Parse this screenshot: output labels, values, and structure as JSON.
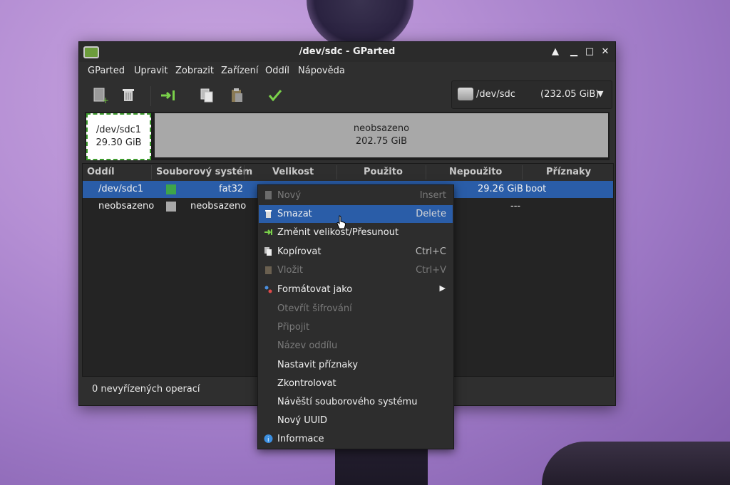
{
  "window": {
    "title": "/dev/sdc - GParted",
    "controls": [
      "▲",
      "▁",
      "□",
      "✕"
    ]
  },
  "menubar": [
    "GParted",
    "Upravit",
    "Zobrazit",
    "Zařízení",
    "Oddíl",
    "Nápověda"
  ],
  "device": {
    "name": "/dev/sdc",
    "size": "(232.05 GiB)"
  },
  "partition_map": [
    {
      "name": "/dev/sdc1",
      "size": "29.30 GiB"
    },
    {
      "name": "neobsazeno",
      "size": "202.75 GiB"
    }
  ],
  "table": {
    "headers": [
      "Oddíl",
      "Souborový systém",
      "Velikost",
      "Použito",
      "Nepoužito",
      "Příznaky"
    ],
    "rows": [
      {
        "partition": "/dev/sdc1",
        "fs": "fat32",
        "fs_color": "#3ea54a",
        "unused": "29.26 GiB",
        "flags": "boot"
      },
      {
        "partition": "neobsazeno",
        "fs": "neobsazeno",
        "fs_color": "#a8a8a8",
        "unused": "---",
        "flags": ""
      }
    ]
  },
  "statusbar": {
    "text": "0 nevyřízených operací"
  },
  "context_menu": {
    "items": [
      {
        "label": "Nový",
        "accel": "Insert",
        "icon": "new-icon",
        "disabled": true
      },
      {
        "label": "Smazat",
        "accel": "Delete",
        "icon": "delete-icon",
        "highlighted": true
      },
      {
        "label": "Změnit velikost/Přesunout",
        "accel": "",
        "icon": "resize-icon"
      },
      {
        "label": "Kopírovat",
        "accel": "Ctrl+C",
        "icon": "copy-icon"
      },
      {
        "label": "Vložit",
        "accel": "Ctrl+V",
        "icon": "paste-icon",
        "disabled": true
      },
      {
        "label": "Formátovat jako",
        "accel": "",
        "icon": "format-icon",
        "submenu": true
      },
      {
        "label": "Otevřít šifrování",
        "accel": "",
        "disabled": true
      },
      {
        "label": "Připojit",
        "accel": "",
        "disabled": true
      },
      {
        "label": "Název oddílu",
        "accel": "",
        "disabled": true
      },
      {
        "label": "Nastavit příznaky",
        "accel": ""
      },
      {
        "label": "Zkontrolovat",
        "accel": ""
      },
      {
        "label": "Návěští souborového systému",
        "accel": ""
      },
      {
        "label": "Nový UUID",
        "accel": ""
      },
      {
        "label": "Informace",
        "accel": "",
        "icon": "info-icon"
      }
    ]
  }
}
